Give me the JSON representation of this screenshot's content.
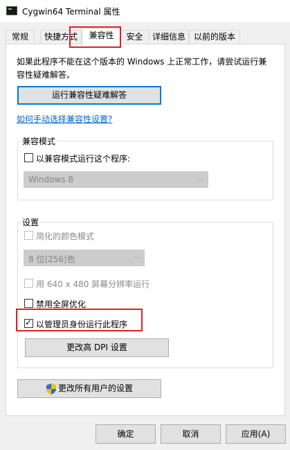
{
  "window": {
    "title": "Cygwin64 Terminal 属性"
  },
  "tabs": [
    {
      "label": "常规"
    },
    {
      "label": "快捷方式"
    },
    {
      "label": "兼容性"
    },
    {
      "label": "安全"
    },
    {
      "label": "详细信息"
    },
    {
      "label": "以前的版本"
    }
  ],
  "compat": {
    "description": "如果此程序不能在这个版本的 Windows 上正常工作，请尝试运行兼容性疑难解答。",
    "troubleshoot_button": "运行兼容性疑难解答",
    "manual_link": "如何手动选择兼容性设置?",
    "mode_group": {
      "label": "兼容模式",
      "checkbox_label": "以兼容模式运行这个程序:",
      "checked": false,
      "os_select_value": "Windows 8"
    },
    "settings_group": {
      "label": "设置",
      "reduced_color": {
        "label": "简化的颜色模式",
        "checked": false,
        "enabled": false
      },
      "color_depth_value": "8 位(256)色",
      "res_640": {
        "label": "用 640 x 480 屏幕分辨率运行",
        "checked": false,
        "enabled": false
      },
      "disable_fullscreen": {
        "label": "禁用全屏优化",
        "checked": false,
        "enabled": true
      },
      "run_as_admin": {
        "label": "以管理员身份运行此程序",
        "checked": true,
        "enabled": true
      },
      "dpi_button": "更改高 DPI 设置"
    },
    "all_users_button": "更改所有用户的设置"
  },
  "footer": {
    "ok": "确定",
    "cancel": "取消",
    "apply": "应用(A)"
  },
  "colors": {
    "highlight": "#e02020",
    "focus": "#0078d7",
    "link": "#0066cc",
    "shield_blue": "#2b6fd6",
    "shield_yellow": "#f2c200"
  }
}
